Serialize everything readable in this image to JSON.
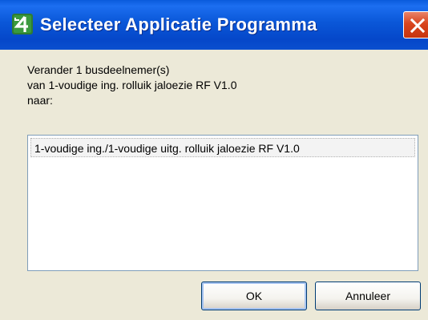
{
  "window": {
    "title": "Selecteer Applicatie Programma",
    "app_icon": "app-4-icon",
    "close_icon": "close-icon",
    "colors": {
      "titlebar": "#0a57d8",
      "close_button": "#d9451e",
      "dialog_background": "#ece9d8"
    }
  },
  "message": {
    "line1": "Verander 1 busdeelnemer(s)",
    "line2": "van 1-voudige ing. rolluik jaloezie RF V1.0",
    "line3": "naar:"
  },
  "list": {
    "items": [
      "1-voudige ing./1-voudige uitg. rolluik jaloezie RF V1.0"
    ]
  },
  "buttons": {
    "ok_label": "OK",
    "cancel_label": "Annuleer"
  }
}
